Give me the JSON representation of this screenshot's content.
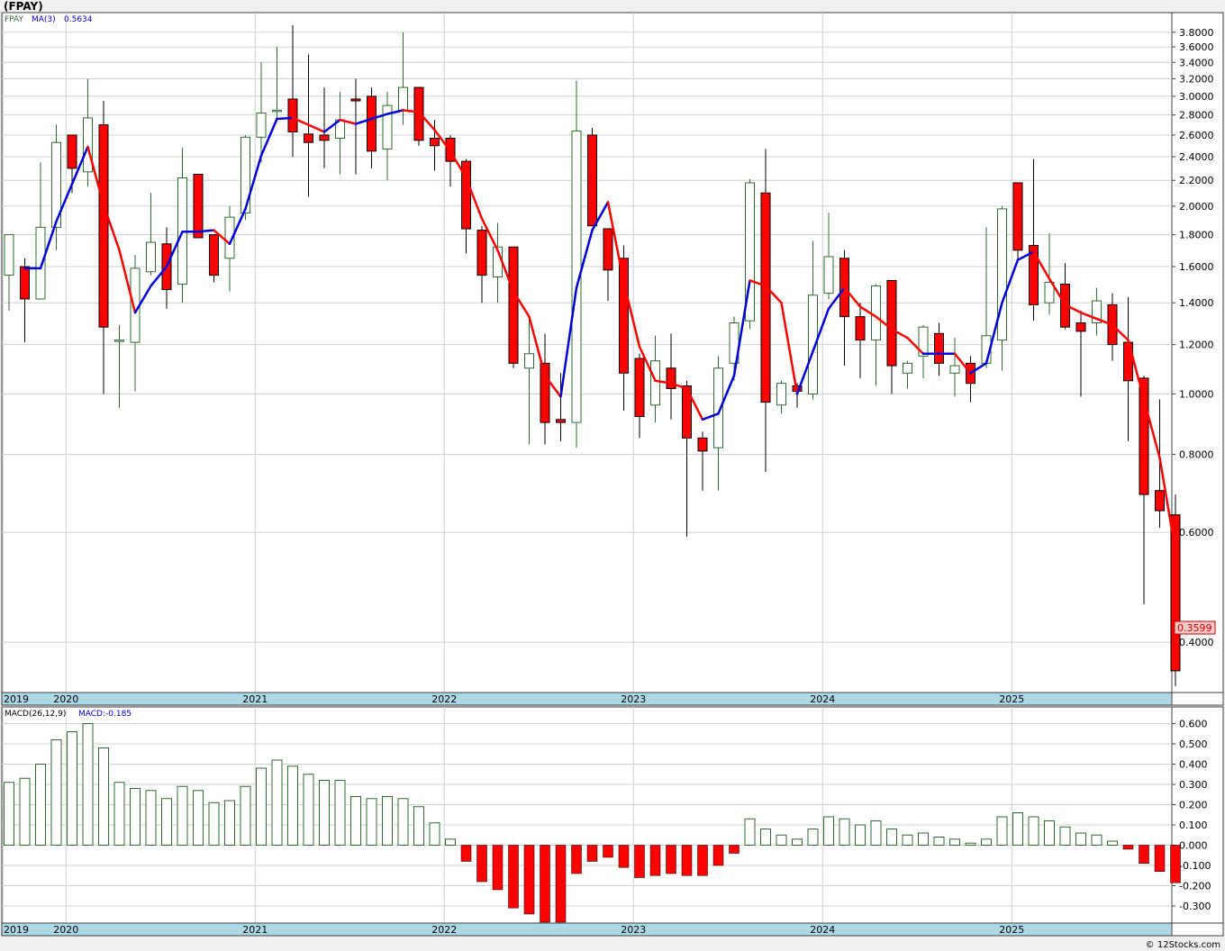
{
  "header": {
    "symbol": "(FPAY)"
  },
  "footer": {
    "credit": "© 12Stocks.com"
  },
  "colors": {
    "up_stroke": "#2e6b2e",
    "down_fill": "#ff0000",
    "ma_up": "#0000dd",
    "ma_down": "#ff0000",
    "grid": "#d0d0d0",
    "axis_band": "#add8e6",
    "last_price_bg": "#ffc8c8",
    "last_price_border": "#cc0000"
  },
  "price_panel": {
    "legend": {
      "symbol": "FPAY",
      "ma_label": "MA(3)",
      "ma_value": "0.5634"
    },
    "last_price_label": "0.3599"
  },
  "macd_panel": {
    "legend": {
      "label": "MACD(26,12,9)",
      "value_label": "MACD:-0.185"
    }
  },
  "chart_data": [
    {
      "type": "candlestick",
      "title": "(FPAY)",
      "interval": "monthly",
      "y_scale": "log",
      "ylim": [
        0.34,
        3.9
      ],
      "y_ticks": [
        "3.8000",
        "3.6000",
        "3.4000",
        "3.2000",
        "3.0000",
        "2.8000",
        "2.6000",
        "2.4000",
        "2.2000",
        "2.0000",
        "1.8000",
        "1.6000",
        "1.4000",
        "1.2000",
        "1.0000",
        "0.8000",
        "0.6000",
        "0.4000"
      ],
      "x_labels": [
        "2019",
        "2020",
        "2021",
        "2022",
        "2023",
        "2024",
        "2025"
      ],
      "x_label_positions": [
        0,
        4,
        16,
        28,
        40,
        52,
        64
      ],
      "candles": [
        {
          "o": 1.55,
          "h": 1.8,
          "l": 1.36,
          "c": 1.8
        },
        {
          "o": 1.6,
          "h": 1.65,
          "l": 1.21,
          "c": 1.42
        },
        {
          "o": 1.42,
          "h": 2.35,
          "l": 1.42,
          "c": 1.85
        },
        {
          "o": 1.85,
          "h": 2.7,
          "l": 1.7,
          "c": 2.53
        },
        {
          "o": 2.6,
          "h": 2.6,
          "l": 2.1,
          "c": 2.3
        },
        {
          "o": 2.27,
          "h": 3.2,
          "l": 2.15,
          "c": 2.77
        },
        {
          "o": 2.7,
          "h": 2.95,
          "l": 1.0,
          "c": 1.28
        },
        {
          "o": 1.22,
          "h": 1.29,
          "l": 0.95,
          "c": 1.22
        },
        {
          "o": 1.21,
          "h": 1.67,
          "l": 1.01,
          "c": 1.59
        },
        {
          "o": 1.57,
          "h": 2.1,
          "l": 1.55,
          "c": 1.75
        },
        {
          "o": 1.74,
          "h": 1.85,
          "l": 1.37,
          "c": 1.47
        },
        {
          "o": 1.5,
          "h": 2.48,
          "l": 1.4,
          "c": 2.22
        },
        {
          "o": 2.25,
          "h": 2.25,
          "l": 1.78,
          "c": 1.78
        },
        {
          "o": 1.8,
          "h": 1.8,
          "l": 1.51,
          "c": 1.55
        },
        {
          "o": 1.65,
          "h": 2.0,
          "l": 1.46,
          "c": 1.92
        },
        {
          "o": 1.95,
          "h": 2.6,
          "l": 1.9,
          "c": 2.58
        },
        {
          "o": 2.58,
          "h": 3.4,
          "l": 2.35,
          "c": 2.82
        },
        {
          "o": 2.85,
          "h": 3.6,
          "l": 2.75,
          "c": 2.85
        },
        {
          "o": 2.97,
          "h": 3.9,
          "l": 2.4,
          "c": 2.63
        },
        {
          "o": 2.61,
          "h": 3.5,
          "l": 2.07,
          "c": 2.53
        },
        {
          "o": 2.6,
          "h": 3.1,
          "l": 2.3,
          "c": 2.55
        },
        {
          "o": 2.57,
          "h": 3.05,
          "l": 2.25,
          "c": 2.75
        },
        {
          "o": 2.97,
          "h": 3.2,
          "l": 2.25,
          "c": 2.95
        },
        {
          "o": 3.0,
          "h": 3.1,
          "l": 2.3,
          "c": 2.45
        },
        {
          "o": 2.47,
          "h": 3.05,
          "l": 2.2,
          "c": 2.9
        },
        {
          "o": 2.85,
          "h": 3.8,
          "l": 2.7,
          "c": 3.1
        },
        {
          "o": 3.1,
          "h": 3.1,
          "l": 2.5,
          "c": 2.55
        },
        {
          "o": 2.57,
          "h": 2.75,
          "l": 2.28,
          "c": 2.5
        },
        {
          "o": 2.57,
          "h": 2.6,
          "l": 2.15,
          "c": 2.36
        },
        {
          "o": 2.36,
          "h": 2.38,
          "l": 1.68,
          "c": 1.84
        },
        {
          "o": 1.83,
          "h": 1.86,
          "l": 1.4,
          "c": 1.55
        },
        {
          "o": 1.54,
          "h": 1.88,
          "l": 1.4,
          "c": 1.72
        },
        {
          "o": 1.72,
          "h": 1.72,
          "l": 1.1,
          "c": 1.12
        },
        {
          "o": 1.1,
          "h": 1.33,
          "l": 0.83,
          "c": 1.16
        },
        {
          "o": 1.12,
          "h": 1.25,
          "l": 0.83,
          "c": 0.9
        },
        {
          "o": 0.91,
          "h": 1.08,
          "l": 0.84,
          "c": 0.9
        },
        {
          "o": 0.9,
          "h": 3.18,
          "l": 0.82,
          "c": 2.64
        },
        {
          "o": 2.6,
          "h": 2.67,
          "l": 1.86,
          "c": 1.86
        },
        {
          "o": 1.84,
          "h": 1.84,
          "l": 1.41,
          "c": 1.58
        },
        {
          "o": 1.65,
          "h": 1.73,
          "l": 0.94,
          "c": 1.08
        },
        {
          "o": 1.14,
          "h": 1.16,
          "l": 0.85,
          "c": 0.92
        },
        {
          "o": 0.96,
          "h": 1.24,
          "l": 0.9,
          "c": 1.13
        },
        {
          "o": 1.1,
          "h": 1.25,
          "l": 0.91,
          "c": 1.02
        },
        {
          "o": 1.03,
          "h": 1.05,
          "l": 0.59,
          "c": 0.85
        },
        {
          "o": 0.85,
          "h": 0.87,
          "l": 0.7,
          "c": 0.81
        },
        {
          "o": 0.82,
          "h": 1.15,
          "l": 0.7,
          "c": 1.1
        },
        {
          "o": 1.12,
          "h": 1.33,
          "l": 1.05,
          "c": 1.3
        },
        {
          "o": 1.31,
          "h": 2.21,
          "l": 1.27,
          "c": 2.18
        },
        {
          "o": 2.1,
          "h": 2.47,
          "l": 0.75,
          "c": 0.97
        },
        {
          "o": 0.96,
          "h": 1.05,
          "l": 0.93,
          "c": 1.04
        },
        {
          "o": 1.03,
          "h": 1.04,
          "l": 0.95,
          "c": 1.01
        },
        {
          "o": 1.0,
          "h": 1.76,
          "l": 0.98,
          "c": 1.44
        },
        {
          "o": 1.45,
          "h": 1.95,
          "l": 1.42,
          "c": 1.66
        },
        {
          "o": 1.65,
          "h": 1.7,
          "l": 1.11,
          "c": 1.33
        },
        {
          "o": 1.33,
          "h": 1.4,
          "l": 1.06,
          "c": 1.22
        },
        {
          "o": 1.22,
          "h": 1.5,
          "l": 1.03,
          "c": 1.49
        },
        {
          "o": 1.52,
          "h": 1.52,
          "l": 1.0,
          "c": 1.11
        },
        {
          "o": 1.08,
          "h": 1.13,
          "l": 1.02,
          "c": 1.12
        },
        {
          "o": 1.15,
          "h": 1.29,
          "l": 1.06,
          "c": 1.28
        },
        {
          "o": 1.25,
          "h": 1.3,
          "l": 1.07,
          "c": 1.12
        },
        {
          "o": 1.08,
          "h": 1.23,
          "l": 0.99,
          "c": 1.11
        },
        {
          "o": 1.12,
          "h": 1.15,
          "l": 0.97,
          "c": 1.04
        },
        {
          "o": 1.12,
          "h": 1.85,
          "l": 1.1,
          "c": 1.24
        },
        {
          "o": 1.22,
          "h": 2.0,
          "l": 1.09,
          "c": 1.98
        },
        {
          "o": 2.18,
          "h": 2.18,
          "l": 1.64,
          "c": 1.7
        },
        {
          "o": 1.73,
          "h": 2.38,
          "l": 1.31,
          "c": 1.39
        },
        {
          "o": 1.4,
          "h": 1.81,
          "l": 1.34,
          "c": 1.51
        },
        {
          "o": 1.5,
          "h": 1.62,
          "l": 1.27,
          "c": 1.28
        },
        {
          "o": 1.3,
          "h": 1.36,
          "l": 0.99,
          "c": 1.26
        },
        {
          "o": 1.3,
          "h": 1.48,
          "l": 1.24,
          "c": 1.41
        },
        {
          "o": 1.39,
          "h": 1.45,
          "l": 1.13,
          "c": 1.2
        },
        {
          "o": 1.21,
          "h": 1.43,
          "l": 0.84,
          "c": 1.05
        },
        {
          "o": 1.06,
          "h": 1.07,
          "l": 0.46,
          "c": 0.69
        },
        {
          "o": 0.7,
          "h": 0.98,
          "l": 0.61,
          "c": 0.65
        },
        {
          "o": 0.64,
          "h": 0.69,
          "l": 0.34,
          "c": 0.3599
        }
      ],
      "ma": {
        "name": "MA(3)",
        "values": [
          null,
          1.59,
          1.59,
          1.89,
          2.17,
          2.49,
          2.01,
          1.7,
          1.35,
          1.49,
          1.6,
          1.82,
          1.82,
          1.83,
          1.74,
          1.98,
          2.41,
          2.76,
          2.77,
          2.7,
          2.63,
          2.75,
          2.71,
          2.76,
          2.81,
          2.85,
          2.83,
          2.65,
          2.45,
          2.22,
          1.91,
          1.7,
          1.46,
          1.33,
          1.07,
          0.99,
          1.48,
          1.83,
          2.03,
          1.51,
          1.19,
          1.05,
          1.04,
          1.02,
          0.91,
          0.93,
          1.07,
          1.52,
          1.49,
          1.4,
          1.0,
          1.17,
          1.37,
          1.48,
          1.38,
          1.33,
          1.27,
          1.23,
          1.16,
          1.16,
          1.16,
          1.08,
          1.12,
          1.4,
          1.64,
          1.69,
          1.53,
          1.39,
          1.35,
          1.32,
          1.29,
          1.22,
          0.98,
          0.79,
          0.56
        ]
      }
    },
    {
      "type": "bar",
      "title": "MACD(26,12,9)",
      "ylim": [
        -0.38,
        0.66
      ],
      "y_ticks": [
        "0.600",
        "0.500",
        "0.400",
        "0.300",
        "0.200",
        "0.100",
        "0.000",
        "-0.100",
        "-0.200",
        "-0.300"
      ],
      "x_labels": [
        "2019",
        "2020",
        "2021",
        "2022",
        "2023",
        "2024",
        "2025"
      ],
      "x_label_positions": [
        0,
        4,
        16,
        28,
        40,
        52,
        64
      ],
      "values": [
        0.31,
        0.33,
        0.4,
        0.52,
        0.56,
        0.6,
        0.48,
        0.31,
        0.28,
        0.27,
        0.23,
        0.29,
        0.27,
        0.21,
        0.22,
        0.29,
        0.38,
        0.42,
        0.39,
        0.35,
        0.32,
        0.32,
        0.24,
        0.23,
        0.24,
        0.23,
        0.19,
        0.11,
        0.03,
        -0.08,
        -0.18,
        -0.22,
        -0.31,
        -0.34,
        -0.38,
        -0.38,
        -0.14,
        -0.08,
        -0.06,
        -0.11,
        -0.16,
        -0.15,
        -0.14,
        -0.15,
        -0.15,
        -0.1,
        -0.04,
        0.13,
        0.08,
        0.05,
        0.03,
        0.08,
        0.14,
        0.13,
        0.1,
        0.12,
        0.08,
        0.05,
        0.06,
        0.04,
        0.03,
        0.01,
        0.03,
        0.14,
        0.16,
        0.14,
        0.12,
        0.09,
        0.06,
        0.05,
        0.02,
        -0.02,
        -0.09,
        -0.13,
        -0.185
      ]
    }
  ]
}
